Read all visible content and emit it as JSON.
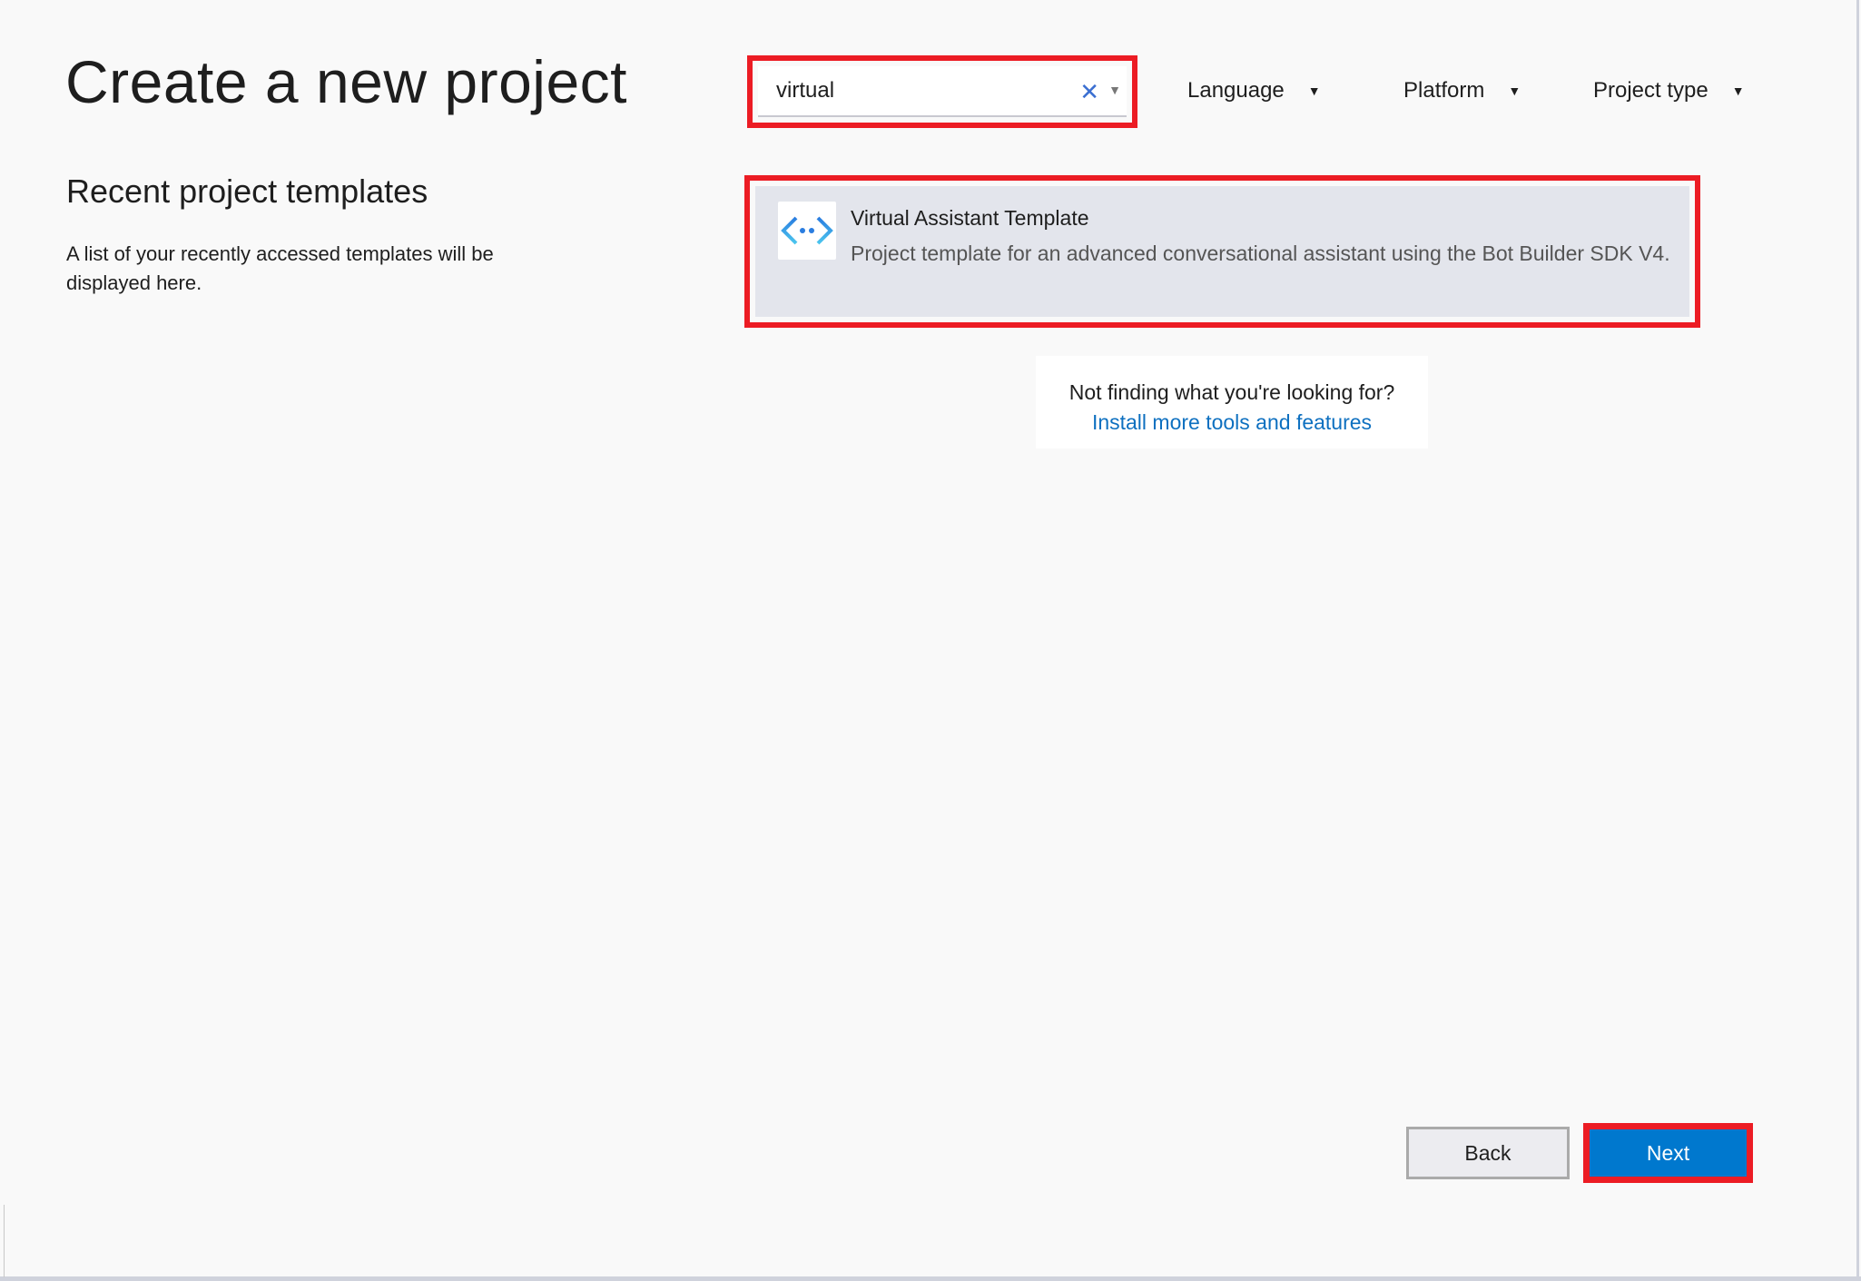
{
  "header": {
    "title": "Create a new project"
  },
  "search": {
    "value": "virtual",
    "clear_icon": "close-icon",
    "dropdown_icon": "caret-down-icon"
  },
  "filters": [
    {
      "label": "Language"
    },
    {
      "label": "Platform"
    },
    {
      "label": "Project type"
    }
  ],
  "recent": {
    "heading": "Recent project templates",
    "description": "A list of your recently accessed templates will be displayed here."
  },
  "results": [
    {
      "title": "Virtual Assistant Template",
      "description": "Project template for an advanced conversational assistant using the Bot Builder SDK V4.",
      "icon": "code-brackets-icon"
    }
  ],
  "not_finding": {
    "text": "Not finding what you're looking for?",
    "link": "Install more tools and features"
  },
  "footer": {
    "back": "Back",
    "next": "Next"
  },
  "colors": {
    "highlight": "#ec1c24",
    "accent": "#0078ce",
    "selected_bg": "#e3e5ec"
  }
}
